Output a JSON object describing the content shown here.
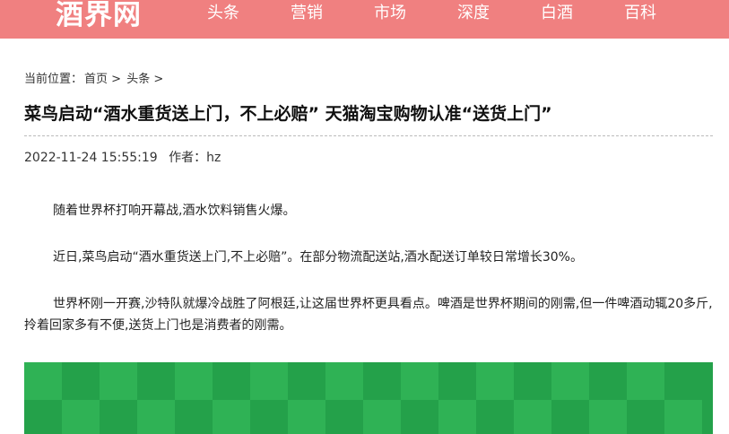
{
  "site": {
    "logo": "酒界网",
    "brand_color": "#f08080"
  },
  "nav": {
    "items": [
      "头条",
      "营销",
      "市场",
      "深度",
      "白酒",
      "百科"
    ]
  },
  "breadcrumb": {
    "prefix": "当前位置：",
    "home": "首页",
    "sep1": " > ",
    "section": "头条",
    "sep2": " >"
  },
  "article": {
    "title": "菜鸟启动“酒水重货送上门，不上必赔” 天猫淘宝购物认准“送货上门”",
    "datetime": "2022-11-24 15:55:19",
    "author_label": "作者：",
    "author": "hz",
    "paragraphs": [
      "随着世界杯打响开幕战,酒水饮料销售火爆。",
      "近日,菜鸟启动“酒水重货送上门,不上必赔”。在部分物流配送站,酒水配送订单较日常增长30%。",
      "世界杯刚一开赛,沙特队就爆冷战胜了阿根廷,让这届世界杯更具看点。啤酒是世界杯期间的刚需,但一件啤酒动辄20多斤,拎着回家多有不便,送货上门也是消费者的刚需。"
    ],
    "image": {
      "banner_text": "",
      "background_color": "#24a14a",
      "text_color": "#f7e53c"
    }
  }
}
